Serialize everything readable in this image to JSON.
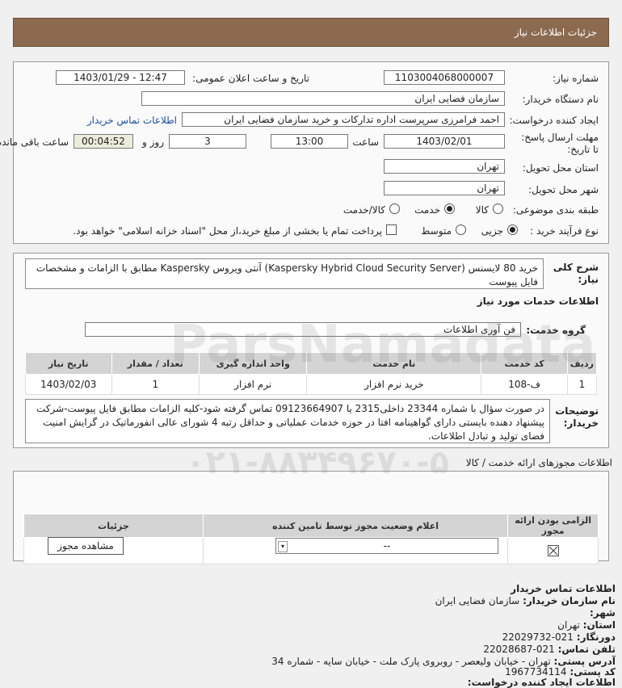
{
  "header": {
    "title": "جزئیات اطلاعات نیاز"
  },
  "form": {
    "need_number_label": "شماره نیاز:",
    "need_number": "1103004068000007",
    "announce_label": "تاریخ و ساعت اعلان عمومی:",
    "announce_value": "1403/01/29 - 12:47",
    "buyer_label": "نام دستگاه خریدار:",
    "buyer_value": "سازمان فضایی ایران",
    "creator_label": "ایجاد کننده درخواست:",
    "creator_value": "احمد فرامرزی سرپرست اداره تدارکات و خرید سازمان فضایی ایران",
    "contact_link": "اطلاعات تماس خریدار",
    "deadline_label": "مهلت ارسال پاسخ: تا تاریخ:",
    "deadline_date": "1403/02/01",
    "time_label": "ساعت",
    "deadline_time": "13:00",
    "days_value": "3",
    "days_label": "روز و",
    "remaining_value": "00:04:52",
    "remaining_label": "ساعت باقی مانده",
    "province_label": "استان محل تحویل:",
    "province_value": "تهران",
    "city_label": "شهر محل تحویل:",
    "city_value": "تهران",
    "category_label": "طبقه بندی موضوعی:",
    "category_options": [
      "کالا",
      "خدمت",
      "کالا/خدمت"
    ],
    "category_selected": "خدمت",
    "process_label": "نوع فرآیند خرید :",
    "process_options": [
      "جزیی",
      "متوسط"
    ],
    "process_selected": "جزیی",
    "payment_note": "پرداخت تمام یا بخشی از مبلغ خرید،از محل \"اسناد خزانه اسلامی\" خواهد بود."
  },
  "summary": {
    "label": "شرح کلی نیاز:",
    "text": "خرید 80 لایسنس (Kaspersky Hybrid Cloud Security Server) آنتی ویروس Kaspersky مطابق با الزامات و مشخصات فایل پیوست",
    "services_title": "اطلاعات خدمات مورد نیاز",
    "service_group_label": "گروه خدمت:",
    "service_group_value": "فن آوری اطلاعات"
  },
  "table": {
    "headers": [
      "ردیف",
      "کد خدمت",
      "نام خدمت",
      "واحد اندازه گیری",
      "تعداد / مقدار",
      "تاریخ نیاز"
    ],
    "rows": [
      [
        "1",
        "ف-108",
        "خرید نرم افزار",
        "نرم افزار",
        "1",
        "1403/02/03"
      ]
    ]
  },
  "buyer_notes": {
    "label": "توضیحات خریدار:",
    "text": "در صورت سؤال با شماره 23344 داخلی2315 یا 09123664907 تماس گرفته شود-کلیه الزامات مطابق فایل پیوست-شرکت پیشنهاد دهنده بایستی دارای گواهینامه افتا در حوزه خدمات عملیاتی و حداقل رتبه 4 شورای عالی انفورماتیک در گرایش امنیت فضای تولید و تبادل اطلاعات."
  },
  "permits": {
    "title": "اطلاعات مجوزهای ارائه خدمت / کالا",
    "headers": [
      "الزامی بودن ارائه مجوز",
      "اعلام وضعیت مجوز توسط تامین کننده",
      "جزئیات"
    ],
    "status_value": "--",
    "view_button": "مشاهده مجوز"
  },
  "contact": {
    "title": "اطلاعات تماس خریدار",
    "org_label": "نام سازمان خریدار:",
    "org_value": "سازمان فضایی ایران",
    "city_label": "شهر:",
    "city_value": "",
    "province_label": "استان:",
    "province_value": "تهران",
    "fax_label": "دورنگار:",
    "fax_value": "021-22029732",
    "phone_label": "تلفن تماس:",
    "phone_value": "021-22028687",
    "address_label": "آدرس پستی:",
    "address_value": "تهران - خیابان ولیعصر - روبروی پارک ملت - خیابان سایه - شماره 34",
    "postal_label": "کد پستی:",
    "postal_value": "1967734114",
    "creator_title": "اطلاعات ایجاد کننده درخواست:"
  },
  "colors": {
    "header_bg": "#8b6a4f",
    "link": "#1a4fa8"
  }
}
